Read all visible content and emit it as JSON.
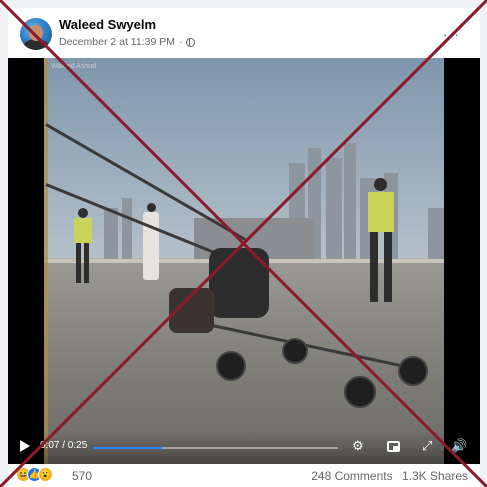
{
  "post": {
    "author": "Waleed Swyelm",
    "timestamp": "December 2 at 11:39 PM",
    "separator": "·",
    "more_label": "···"
  },
  "video": {
    "watermark": "Waleed Ashraf",
    "time_display": "0:07 / 0:25",
    "progress": 0.28
  },
  "footer": {
    "reaction_count": "570",
    "comments": "248 Comments",
    "shares": "1.3K Shares",
    "reactions": [
      {
        "name": "haha-icon",
        "color": "#f7b125"
      },
      {
        "name": "like-icon",
        "color": "#1877f2"
      },
      {
        "name": "wow-icon",
        "color": "#f7b125"
      }
    ]
  },
  "overlay": {
    "x_color": "#8b1a2b"
  }
}
